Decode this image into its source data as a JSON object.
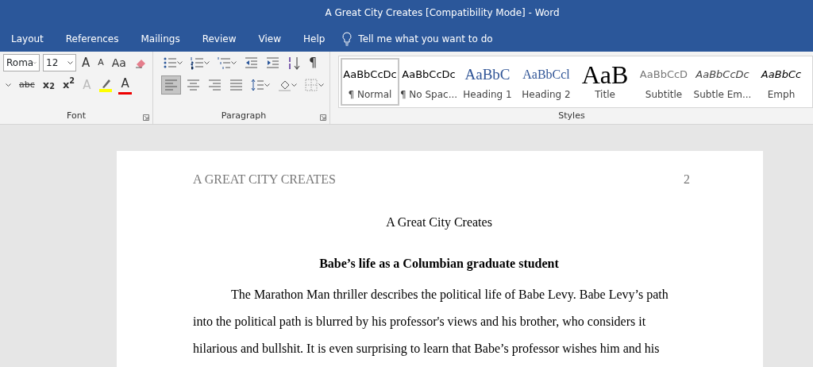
{
  "window": {
    "title": "A Great City Creates [Compatibility Mode]  -  Word"
  },
  "tabs": [
    {
      "label": "Layout",
      "selected": false
    },
    {
      "label": "References",
      "selected": false
    },
    {
      "label": "Mailings",
      "selected": false
    },
    {
      "label": "Review",
      "selected": false
    },
    {
      "label": "View",
      "selected": false
    },
    {
      "label": "Help",
      "selected": false
    }
  ],
  "tell_me": {
    "placeholder": "Tell me what you want to do"
  },
  "font_group": {
    "label": "Font",
    "font_name": "Roma",
    "font_size": "12",
    "row_1": [
      {
        "kind": "grow",
        "label": "A"
      },
      {
        "kind": "shrink",
        "label": "A"
      },
      {
        "kind": "case",
        "label": "Aa"
      },
      {
        "kind": "clear"
      }
    ],
    "row_2": [
      {
        "kind": "caret"
      },
      {
        "kind": "strike",
        "label": "abc"
      },
      {
        "kind": "sub",
        "label": "x",
        "index": "2"
      },
      {
        "kind": "sup",
        "label": "x",
        "index": "2"
      },
      {
        "kind": "effects",
        "label": "A"
      },
      {
        "kind": "highlight"
      },
      {
        "kind": "color",
        "label": "A"
      }
    ]
  },
  "paragraph_group": {
    "label": "Paragraph",
    "row_1": [
      {
        "kind": "bullets",
        "selected": false
      },
      {
        "kind": "numbering",
        "selected": false
      },
      {
        "kind": "multilevel",
        "selected": false
      },
      {
        "kind": "outdent",
        "selected": false
      },
      {
        "kind": "indent",
        "selected": false
      },
      {
        "kind": "sort",
        "selected": false
      },
      {
        "kind": "pilcrow",
        "label": "¶",
        "selected": false
      }
    ],
    "row_2": [
      {
        "kind": "align-left",
        "selected": true
      },
      {
        "kind": "align-center",
        "selected": false
      },
      {
        "kind": "align-right",
        "selected": false
      },
      {
        "kind": "justify",
        "selected": false
      },
      {
        "kind": "spacing",
        "selected": false
      },
      {
        "kind": "shading",
        "selected": false
      },
      {
        "kind": "borders",
        "selected": false
      }
    ]
  },
  "styles_group": {
    "label": "Styles",
    "styles": [
      {
        "kind": "normal",
        "preview": "AaBbCcDc",
        "label": "¶ Normal",
        "selected": true
      },
      {
        "kind": "nospacing",
        "preview": "AaBbCcDc",
        "label": "¶ No Spac...",
        "selected": false
      },
      {
        "kind": "heading1",
        "preview": "AaBbC",
        "label": "Heading 1",
        "selected": false
      },
      {
        "kind": "heading2",
        "preview": "AaBbCcl",
        "label": "Heading 2",
        "selected": false
      },
      {
        "kind": "title",
        "preview": "AaB",
        "label": "Title",
        "selected": false
      },
      {
        "kind": "subtitle",
        "preview": "AaBbCcD",
        "label": "Subtitle",
        "selected": false
      },
      {
        "kind": "subtle",
        "preview": "AaBbCcDc",
        "label": "Subtle Em...",
        "selected": false
      },
      {
        "kind": "emphasis",
        "preview": "AaBbCc",
        "label": "Emph",
        "selected": false
      }
    ]
  },
  "document": {
    "header": "A GREAT CITY CREATES",
    "page_number": "2",
    "title": "A Great City Creates",
    "heading": "Babe’s life as a Columbian graduate student",
    "paragraph": "The Marathon Man thriller describes the political life of Babe Levy. Babe Levy’s path into the political path is blurred by his professor's views and his brother, who considers it hilarious and bullshit. It is even surprising to learn that Babe’s professor wishes him and his"
  }
}
